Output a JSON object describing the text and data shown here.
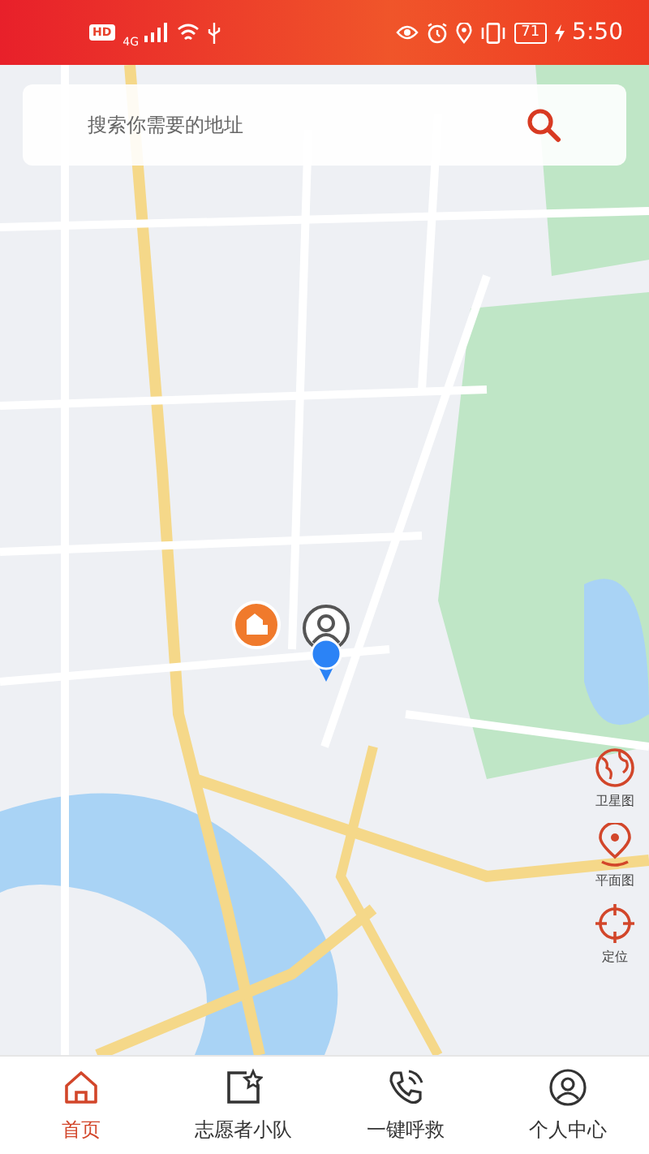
{
  "status_bar": {
    "hd": "HD",
    "network": "4G",
    "battery": "71",
    "time": "5:50"
  },
  "search": {
    "placeholder": "搜索你需要的地址"
  },
  "map_buttons": [
    {
      "kind": "satellite",
      "label": "卫星图"
    },
    {
      "kind": "plan",
      "label": "平面图"
    },
    {
      "kind": "locate",
      "label": "定位"
    }
  ],
  "tabs": [
    {
      "kind": "home",
      "label": "首页",
      "selected": true
    },
    {
      "kind": "team",
      "label": "志愿者小队",
      "selected": false
    },
    {
      "kind": "call",
      "label": "一键呼救",
      "selected": false
    },
    {
      "kind": "user",
      "label": "个人中心",
      "selected": false
    }
  ]
}
